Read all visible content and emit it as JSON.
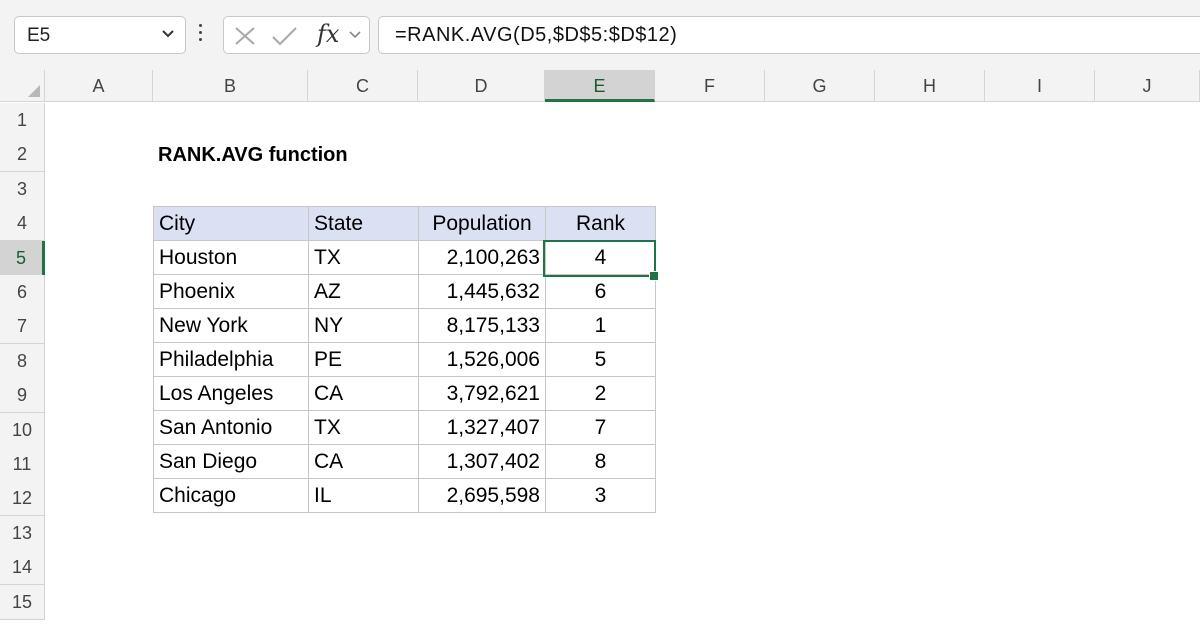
{
  "formula_bar": {
    "name_box": "E5",
    "formula": "=RANK.AVG(D5,$D$5:$D$12)"
  },
  "icons": {
    "name_box_dropdown": "chevron-down-icon",
    "more_options": "vertical-dots-icon",
    "cancel": "x-icon",
    "enter": "check-icon",
    "insert_function": "fx-icon",
    "expand": "chevron-down-icon"
  },
  "fx_label": "fx",
  "columns": [
    "A",
    "B",
    "C",
    "D",
    "E",
    "F",
    "G",
    "H",
    "I",
    "J"
  ],
  "selected_column": "E",
  "rows": [
    "1",
    "2",
    "3",
    "4",
    "5",
    "6",
    "7",
    "8",
    "9",
    "10",
    "11",
    "12",
    "13",
    "14",
    "15"
  ],
  "selected_row": "5",
  "sheet": {
    "title": "RANK.AVG function",
    "table": {
      "headers": [
        "City",
        "State",
        "Population",
        "Rank"
      ],
      "rows": [
        [
          "Houston",
          "TX",
          "2,100,263",
          "4"
        ],
        [
          "Phoenix",
          "AZ",
          "1,445,632",
          "6"
        ],
        [
          "New York",
          "NY",
          "8,175,133",
          "1"
        ],
        [
          "Philadelphia",
          "PE",
          "1,526,006",
          "5"
        ],
        [
          "Los Angeles",
          "CA",
          "3,792,621",
          "2"
        ],
        [
          "San Antonio",
          "TX",
          "1,327,407",
          "7"
        ],
        [
          "San Diego",
          "CA",
          "1,307,402",
          "8"
        ],
        [
          "Chicago",
          "IL",
          "2,695,598",
          "3"
        ]
      ]
    }
  },
  "colors": {
    "selection": "#217346",
    "table_header": "#d9e1f2",
    "chrome": "#f3f3f3"
  }
}
